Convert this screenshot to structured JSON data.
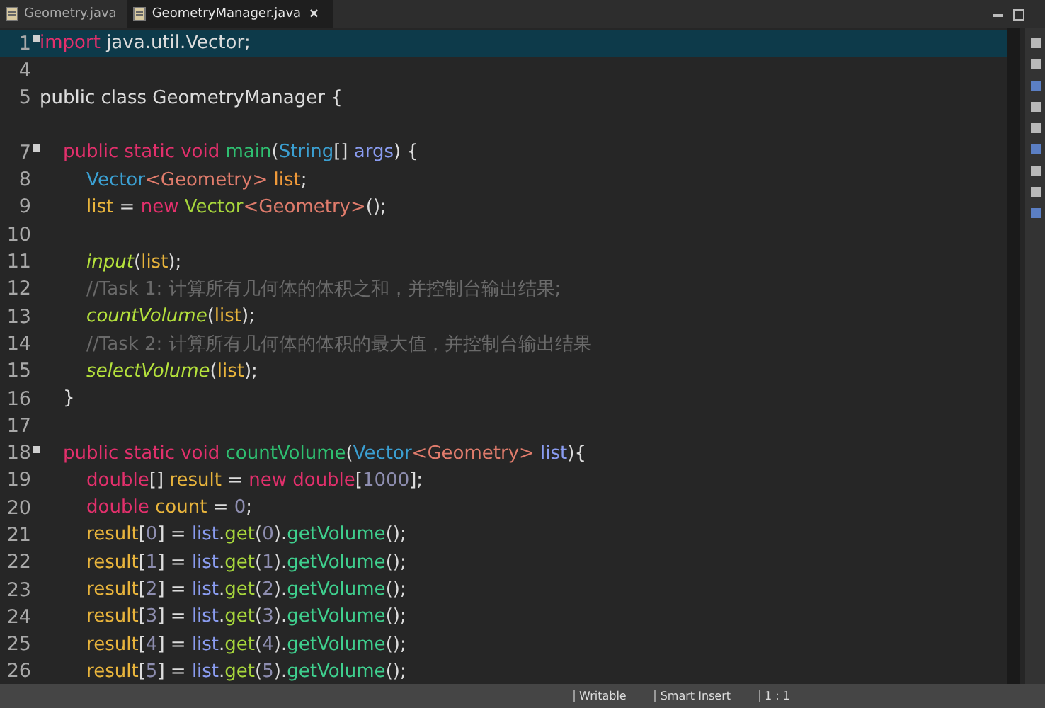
{
  "tabs": [
    {
      "label": "Geometry.java",
      "selected": false,
      "closable": false
    },
    {
      "label": "GeometryManager.java",
      "selected": true,
      "closable": true,
      "close": "×"
    }
  ],
  "editor": {
    "lines": [
      {
        "number": "1",
        "fold": true,
        "current": true,
        "tokens": [
          {
            "kind": "keyword",
            "text": "import"
          },
          {
            "kind": "plain",
            "text": " java.util.Vector;"
          }
        ]
      },
      {
        "number": "4",
        "current": false
      },
      {
        "number": "5",
        "current": false,
        "tokens": [
          {
            "kind": "plain",
            "text": "public class GeometryManager {"
          }
        ]
      },
      {
        "current": false
      },
      {
        "number": "7",
        "fold": true,
        "current": false,
        "tokens": [
          {
            "kind": "keyword",
            "text": "    public static void "
          },
          {
            "kind": "declaration",
            "text": "main"
          },
          {
            "kind": "plain",
            "text": "("
          },
          {
            "kind": "type",
            "text": "String"
          },
          {
            "kind": "plain",
            "text": "[] "
          },
          {
            "kind": "parameter",
            "text": "args"
          },
          {
            "kind": "plain",
            "text": ") {"
          }
        ]
      },
      {
        "number": "8",
        "current": false,
        "tokens": [
          {
            "kind": "type",
            "text": "        Vector"
          },
          {
            "kind": "generic",
            "text": "<Geometry>"
          },
          {
            "kind": "field",
            "text": " list"
          },
          {
            "kind": "plain",
            "text": ";"
          }
        ]
      },
      {
        "number": "9",
        "current": false,
        "tokens": [
          {
            "kind": "local",
            "text": "        list"
          },
          {
            "kind": "plain",
            "text": " = "
          },
          {
            "kind": "keyword",
            "text": "new "
          },
          {
            "kind": "call",
            "text": "Vector"
          },
          {
            "kind": "generic",
            "text": "<Geometry>"
          },
          {
            "kind": "plain",
            "text": "();"
          }
        ]
      },
      {
        "number": "10",
        "current": false
      },
      {
        "number": "11",
        "current": false,
        "tokens": [
          {
            "kind": "static-call",
            "text": "        input"
          },
          {
            "kind": "plain",
            "text": "("
          },
          {
            "kind": "local",
            "text": "list"
          },
          {
            "kind": "plain",
            "text": ");"
          }
        ]
      },
      {
        "number": "12",
        "current": false,
        "tokens": [
          {
            "kind": "comment",
            "text": "        //Task 1: 计算所有几何体的体积之和，并控制台输出结果;"
          }
        ]
      },
      {
        "number": "13",
        "current": false,
        "tokens": [
          {
            "kind": "static-call",
            "text": "        countVolume"
          },
          {
            "kind": "plain",
            "text": "("
          },
          {
            "kind": "local",
            "text": "list"
          },
          {
            "kind": "plain",
            "text": ");"
          }
        ]
      },
      {
        "number": "14",
        "current": false,
        "tokens": [
          {
            "kind": "comment",
            "text": "        //Task 2: 计算所有几何体的体积的最大值，并控制台输出结果"
          }
        ]
      },
      {
        "number": "15",
        "current": false,
        "tokens": [
          {
            "kind": "static-call",
            "text": "        selectVolume"
          },
          {
            "kind": "plain",
            "text": "("
          },
          {
            "kind": "local",
            "text": "list"
          },
          {
            "kind": "plain",
            "text": ");"
          }
        ]
      },
      {
        "number": "16",
        "current": false,
        "tokens": [
          {
            "kind": "plain",
            "text": "    }"
          }
        ]
      },
      {
        "number": "17",
        "current": false
      },
      {
        "number": "18",
        "fold": true,
        "current": false,
        "tokens": [
          {
            "kind": "keyword",
            "text": "    public static void "
          },
          {
            "kind": "declaration",
            "text": "countVolume"
          },
          {
            "kind": "plain",
            "text": "("
          },
          {
            "kind": "type",
            "text": "Vector"
          },
          {
            "kind": "generic",
            "text": "<Geometry>"
          },
          {
            "kind": "parameter",
            "text": " list"
          },
          {
            "kind": "plain",
            "text": "){"
          }
        ]
      },
      {
        "number": "19",
        "current": false,
        "tokens": [
          {
            "kind": "keyword",
            "text": "        double"
          },
          {
            "kind": "plain",
            "text": "[] "
          },
          {
            "kind": "local",
            "text": "result"
          },
          {
            "kind": "plain",
            "text": " = "
          },
          {
            "kind": "keyword",
            "text": "new double"
          },
          {
            "kind": "plain",
            "text": "["
          },
          {
            "kind": "number",
            "text": "1000"
          },
          {
            "kind": "plain",
            "text": "];"
          }
        ]
      },
      {
        "number": "20",
        "current": false,
        "tokens": [
          {
            "kind": "keyword",
            "text": "        double "
          },
          {
            "kind": "local",
            "text": "count"
          },
          {
            "kind": "plain",
            "text": " = "
          },
          {
            "kind": "number",
            "text": "0"
          },
          {
            "kind": "plain",
            "text": ";"
          }
        ]
      },
      {
        "number": "21",
        "current": false,
        "tokens": [
          {
            "kind": "local",
            "text": "        result"
          },
          {
            "kind": "plain",
            "text": "["
          },
          {
            "kind": "number",
            "text": "0"
          },
          {
            "kind": "plain",
            "text": "] = "
          },
          {
            "kind": "parameter",
            "text": "list"
          },
          {
            "kind": "plain",
            "text": "."
          },
          {
            "kind": "call",
            "text": "get"
          },
          {
            "kind": "plain",
            "text": "("
          },
          {
            "kind": "number",
            "text": "0"
          },
          {
            "kind": "plain",
            "text": ")."
          },
          {
            "kind": "method",
            "text": "getVolume"
          },
          {
            "kind": "plain",
            "text": "();"
          }
        ]
      },
      {
        "number": "22",
        "current": false,
        "tokens": [
          {
            "kind": "local",
            "text": "        result"
          },
          {
            "kind": "plain",
            "text": "["
          },
          {
            "kind": "number",
            "text": "1"
          },
          {
            "kind": "plain",
            "text": "] = "
          },
          {
            "kind": "parameter",
            "text": "list"
          },
          {
            "kind": "plain",
            "text": "."
          },
          {
            "kind": "call",
            "text": "get"
          },
          {
            "kind": "plain",
            "text": "("
          },
          {
            "kind": "number",
            "text": "1"
          },
          {
            "kind": "plain",
            "text": ")."
          },
          {
            "kind": "method",
            "text": "getVolume"
          },
          {
            "kind": "plain",
            "text": "();"
          }
        ]
      },
      {
        "number": "23",
        "current": false,
        "tokens": [
          {
            "kind": "local",
            "text": "        result"
          },
          {
            "kind": "plain",
            "text": "["
          },
          {
            "kind": "number",
            "text": "2"
          },
          {
            "kind": "plain",
            "text": "] = "
          },
          {
            "kind": "parameter",
            "text": "list"
          },
          {
            "kind": "plain",
            "text": "."
          },
          {
            "kind": "call",
            "text": "get"
          },
          {
            "kind": "plain",
            "text": "("
          },
          {
            "kind": "number",
            "text": "2"
          },
          {
            "kind": "plain",
            "text": ")."
          },
          {
            "kind": "method",
            "text": "getVolume"
          },
          {
            "kind": "plain",
            "text": "();"
          }
        ]
      },
      {
        "number": "24",
        "current": false,
        "tokens": [
          {
            "kind": "local",
            "text": "        result"
          },
          {
            "kind": "plain",
            "text": "["
          },
          {
            "kind": "number",
            "text": "3"
          },
          {
            "kind": "plain",
            "text": "] = "
          },
          {
            "kind": "parameter",
            "text": "list"
          },
          {
            "kind": "plain",
            "text": "."
          },
          {
            "kind": "call",
            "text": "get"
          },
          {
            "kind": "plain",
            "text": "("
          },
          {
            "kind": "number",
            "text": "3"
          },
          {
            "kind": "plain",
            "text": ")."
          },
          {
            "kind": "method",
            "text": "getVolume"
          },
          {
            "kind": "plain",
            "text": "();"
          }
        ]
      },
      {
        "number": "25",
        "current": false,
        "tokens": [
          {
            "kind": "local",
            "text": "        result"
          },
          {
            "kind": "plain",
            "text": "["
          },
          {
            "kind": "number",
            "text": "4"
          },
          {
            "kind": "plain",
            "text": "] = "
          },
          {
            "kind": "parameter",
            "text": "list"
          },
          {
            "kind": "plain",
            "text": "."
          },
          {
            "kind": "call",
            "text": "get"
          },
          {
            "kind": "plain",
            "text": "("
          },
          {
            "kind": "number",
            "text": "4"
          },
          {
            "kind": "plain",
            "text": ")."
          },
          {
            "kind": "method",
            "text": "getVolume"
          },
          {
            "kind": "plain",
            "text": "();"
          }
        ]
      },
      {
        "number": "26",
        "current": false,
        "tokens": [
          {
            "kind": "local",
            "text": "        result"
          },
          {
            "kind": "plain",
            "text": "["
          },
          {
            "kind": "number",
            "text": "5"
          },
          {
            "kind": "plain",
            "text": "] = "
          },
          {
            "kind": "parameter",
            "text": "list"
          },
          {
            "kind": "plain",
            "text": "."
          },
          {
            "kind": "call",
            "text": "get"
          },
          {
            "kind": "plain",
            "text": "("
          },
          {
            "kind": "number",
            "text": "5"
          },
          {
            "kind": "plain",
            "text": ")."
          },
          {
            "kind": "method",
            "text": "getVolume"
          },
          {
            "kind": "plain",
            "text": "();"
          }
        ]
      }
    ]
  },
  "status_bar": {
    "items": [
      "Writable",
      "Smart Insert",
      "1 : 1"
    ]
  }
}
